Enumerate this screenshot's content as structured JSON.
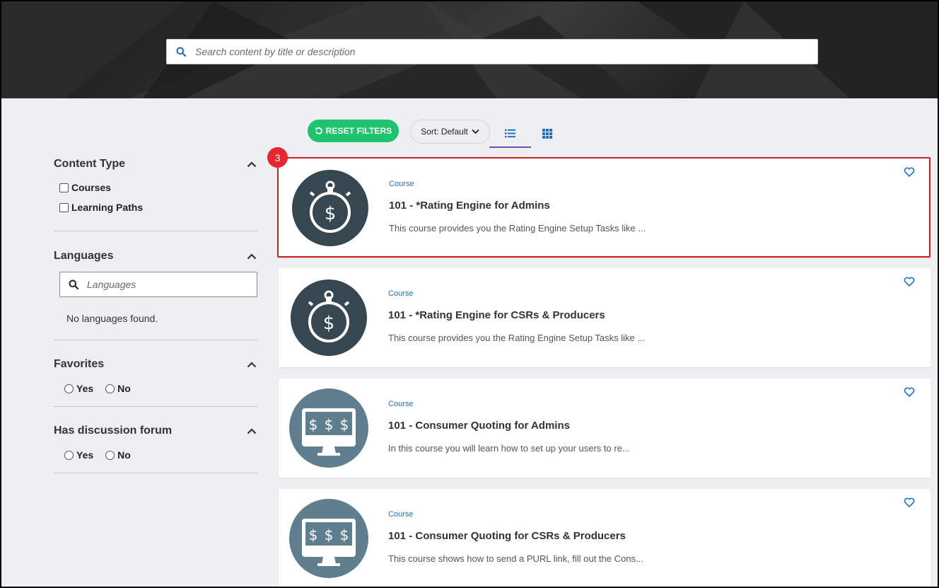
{
  "search": {
    "placeholder": "Search content by title or description"
  },
  "toolbar": {
    "reset_label": "RESET FILTERS",
    "sort_label": "Sort: Default"
  },
  "filters": {
    "content_type": {
      "title": "Content Type",
      "options": [
        "Courses",
        "Learning Paths"
      ]
    },
    "languages": {
      "title": "Languages",
      "placeholder": "Languages",
      "empty_text": "No languages found."
    },
    "favorites": {
      "title": "Favorites",
      "options": [
        "Yes",
        "No"
      ]
    },
    "discussion": {
      "title": "Has discussion forum",
      "options": [
        "Yes",
        "No"
      ]
    }
  },
  "annotation": {
    "badge": "3"
  },
  "cards": [
    {
      "type": "Course",
      "title": "101 - *Rating Engine for Admins",
      "desc": "This course provides you the Rating Engine Setup Tasks like ...",
      "icon": "stopwatch-dollar-icon"
    },
    {
      "type": "Course",
      "title": "101 - *Rating Engine for CSRs & Producers",
      "desc": "This course provides you the Rating Engine Setup Tasks like ...",
      "icon": "stopwatch-dollar-icon"
    },
    {
      "type": "Course",
      "title": "101 - Consumer Quoting for Admins",
      "desc": "In this course you will learn how to set up your users to re...",
      "icon": "monitor-dollars-icon"
    },
    {
      "type": "Course",
      "title": "101 - Consumer Quoting for CSRs & Producers",
      "desc": "This course shows how to send a PURL link, fill out the Cons...",
      "icon": "monitor-dollars-icon"
    }
  ],
  "colors": {
    "accent_green": "#1fc26d",
    "link_blue": "#1f6fc4",
    "highlight_red": "#cc1f2a",
    "tab_underline": "#6b4fbb"
  }
}
